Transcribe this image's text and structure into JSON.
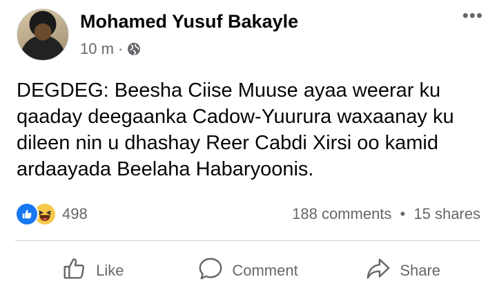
{
  "post": {
    "author": "Mohamed Yusuf Bakayle",
    "time": "10 m",
    "separator": "·",
    "privacy_icon": "globe-icon",
    "more_label": "•••",
    "text": "DEGDEG: Beesha Ciise Muuse ayaa weerar ku qaaday deegaanka Cadow-Yuurura waxaanay ku dileen nin u dhashay Reer Cabdi Xirsi oo kamid ardaayada Beelaha Habaryoonis."
  },
  "stats": {
    "reaction_icons": [
      "like-icon",
      "haha-icon"
    ],
    "reaction_count": "498",
    "comments": "188 comments",
    "dot": "•",
    "shares": "15 shares"
  },
  "actions": {
    "like": "Like",
    "comment": "Comment",
    "share": "Share"
  },
  "colors": {
    "like_blue": "#1877f2",
    "haha_yellow": "#f7c84a",
    "secondary_text": "#65676b",
    "divider": "#ced0d4"
  }
}
